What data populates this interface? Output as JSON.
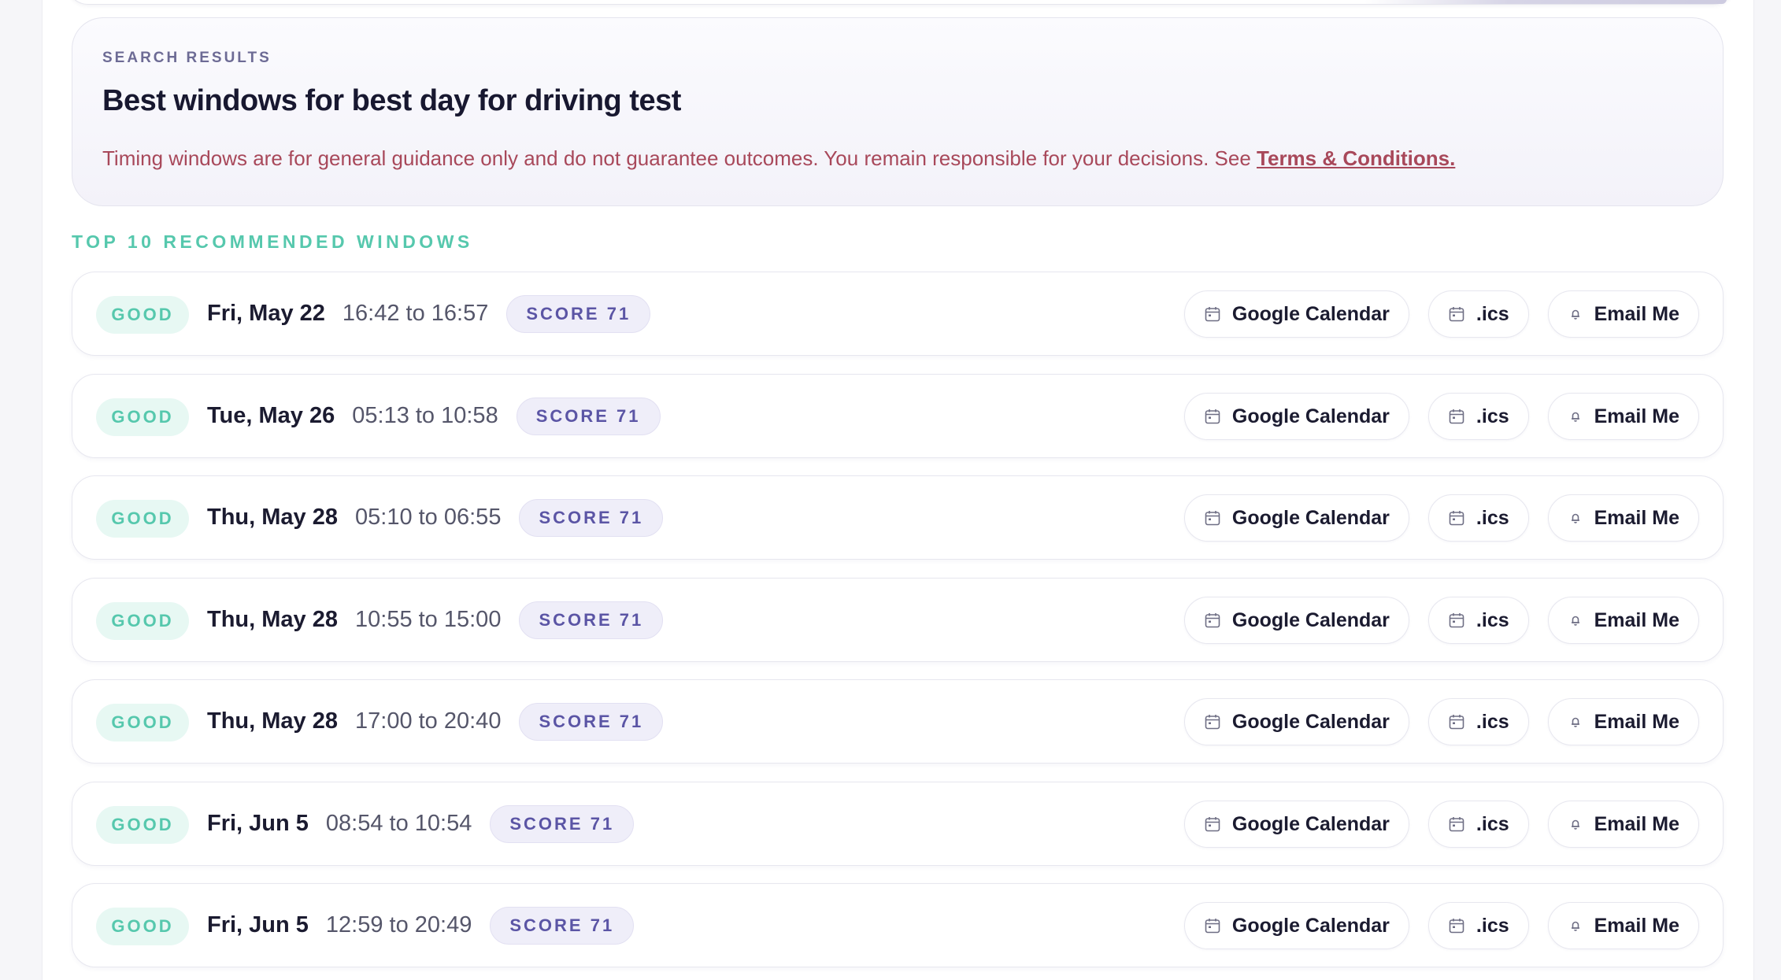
{
  "search": {
    "eyebrow": "SEARCH RESULTS",
    "title": "Best windows for best day for driving test",
    "disclaimer_text": "Timing windows are for general guidance only and do not guarantee outcomes. You remain responsible for your decisions. See ",
    "terms_link": "Terms & Conditions."
  },
  "section_label": "TOP 10 RECOMMENDED WINDOWS",
  "actions": {
    "google_calendar": "Google Calendar",
    "ics": ".ics",
    "email": "Email Me",
    "icons": [
      "calendar-icon",
      "calendar-icon",
      "bell-icon"
    ]
  },
  "colors": {
    "good_text": "#56c8ad",
    "good_bg": "#e7f8f3",
    "score_text": "#5b55a5",
    "score_bg": "#efeef9",
    "disclaimer": "#a8485a"
  },
  "windows": [
    {
      "rating": "GOOD",
      "date": "Fri, May 22",
      "time": "16:42 to 16:57",
      "score": "SCORE 71"
    },
    {
      "rating": "GOOD",
      "date": "Tue, May 26",
      "time": "05:13 to 10:58",
      "score": "SCORE 71"
    },
    {
      "rating": "GOOD",
      "date": "Thu, May 28",
      "time": "05:10 to 06:55",
      "score": "SCORE 71"
    },
    {
      "rating": "GOOD",
      "date": "Thu, May 28",
      "time": "10:55 to 15:00",
      "score": "SCORE 71"
    },
    {
      "rating": "GOOD",
      "date": "Thu, May 28",
      "time": "17:00 to 20:40",
      "score": "SCORE 71"
    },
    {
      "rating": "GOOD",
      "date": "Fri, Jun 5",
      "time": "08:54 to 10:54",
      "score": "SCORE 71"
    },
    {
      "rating": "GOOD",
      "date": "Fri, Jun 5",
      "time": "12:59 to 20:49",
      "score": "SCORE 71"
    }
  ]
}
